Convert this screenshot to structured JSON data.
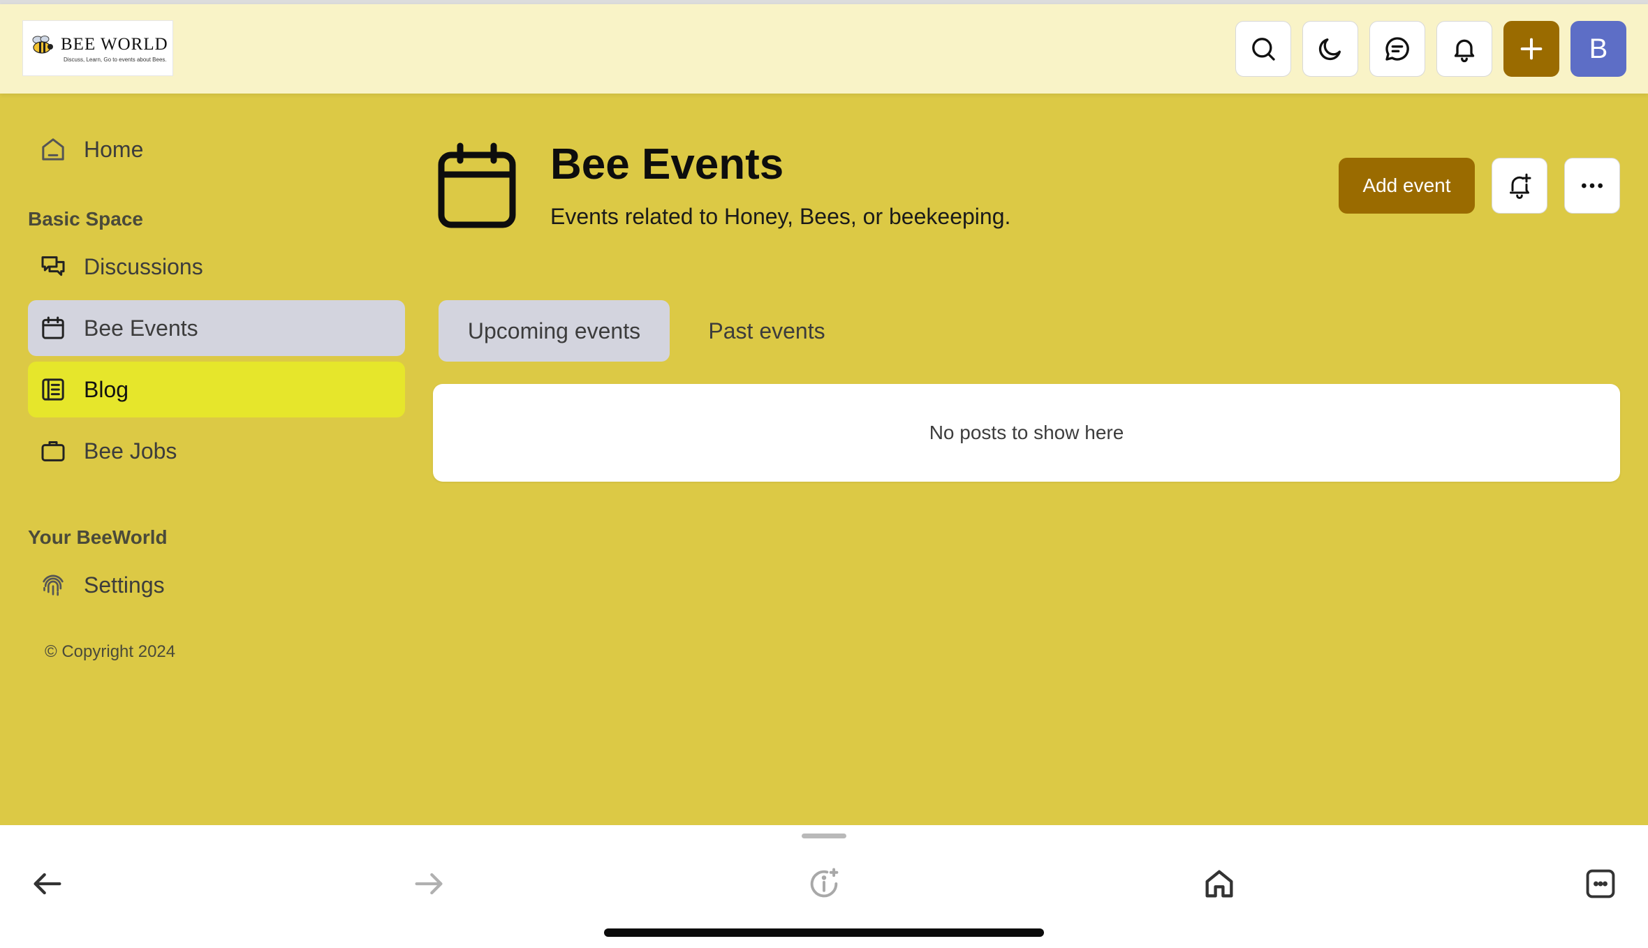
{
  "header": {
    "logo": {
      "title": "BEE WORLD",
      "tagline": "Discuss, Learn, Go to events about Bees."
    },
    "avatar_letter": "B"
  },
  "sidebar": {
    "home": "Home",
    "section_basic": "Basic Space",
    "items": [
      {
        "label": "Discussions"
      },
      {
        "label": "Bee Events"
      },
      {
        "label": "Blog"
      },
      {
        "label": "Bee Jobs"
      }
    ],
    "section_your": "Your BeeWorld",
    "settings": "Settings",
    "copyright": "© Copyright 2024"
  },
  "main": {
    "title": "Bee Events",
    "description": "Events related to Honey, Bees, or beekeeping.",
    "add_event": "Add event",
    "tabs": [
      {
        "label": "Upcoming events"
      },
      {
        "label": "Past events"
      }
    ],
    "empty_message": "No posts to show here"
  },
  "colors": {
    "background": "#dcc945",
    "header": "#f9f3c7",
    "accent": "#9a6b00",
    "avatar": "#5d6ec6",
    "highlight": "#e6e62b",
    "active": "#d3d4de"
  }
}
